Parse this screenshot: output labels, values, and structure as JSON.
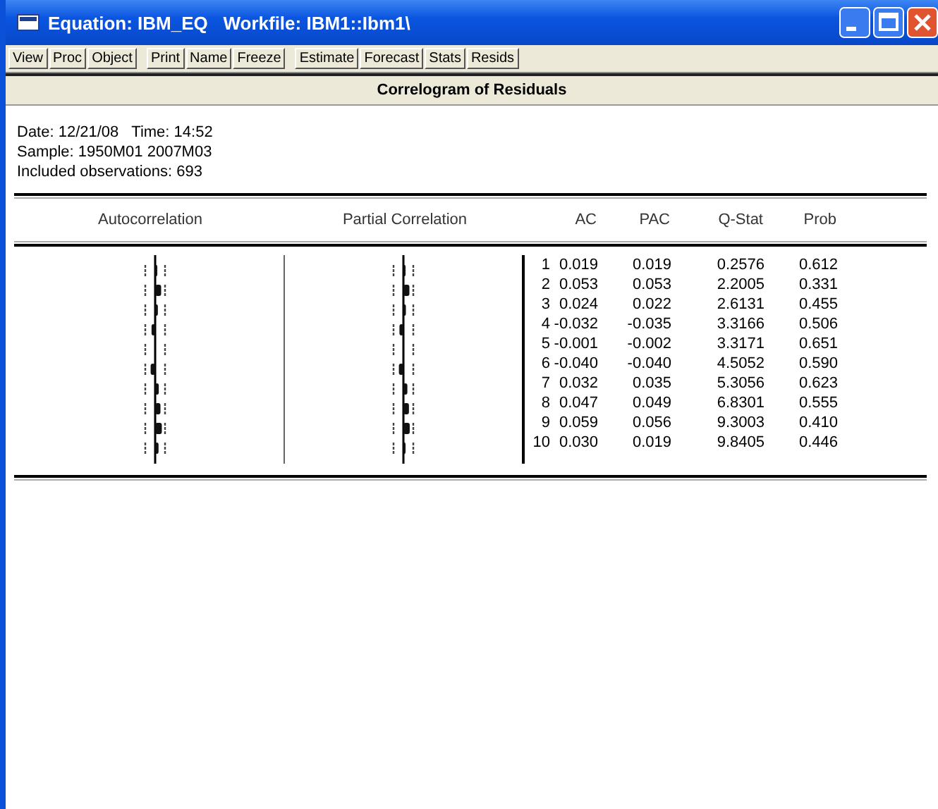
{
  "window": {
    "title": "Equation: IBM_EQ   Workfile: IBM1::Ibm1\\"
  },
  "toolbar": [
    "View",
    "Proc",
    "Object",
    "Print",
    "Name",
    "Freeze",
    "Estimate",
    "Forecast",
    "Stats",
    "Resids"
  ],
  "heading": "Correlogram of Residuals",
  "info": [
    "Date: 12/21/08   Time: 14:52",
    "Sample: 1950M01 2007M03",
    "Included observations: 693"
  ],
  "columns": [
    "Autocorrelation",
    "Partial Correlation",
    "AC",
    "PAC",
    "Q-Stat",
    "Prob"
  ],
  "rows": [
    {
      "lag": "1",
      "ac": "0.019",
      "pac": "0.019",
      "q": "0.2576",
      "prob": "0.612"
    },
    {
      "lag": "2",
      "ac": "0.053",
      "pac": "0.053",
      "q": "2.2005",
      "prob": "0.331"
    },
    {
      "lag": "3",
      "ac": "0.024",
      "pac": "0.022",
      "q": "2.6131",
      "prob": "0.455"
    },
    {
      "lag": "4",
      "ac": "-0.032",
      "pac": "-0.035",
      "q": "3.3166",
      "prob": "0.506"
    },
    {
      "lag": "5",
      "ac": "-0.001",
      "pac": "-0.002",
      "q": "3.3171",
      "prob": "0.651"
    },
    {
      "lag": "6",
      "ac": "-0.040",
      "pac": "-0.040",
      "q": "4.5052",
      "prob": "0.590"
    },
    {
      "lag": "7",
      "ac": "0.032",
      "pac": "0.035",
      "q": "5.3056",
      "prob": "0.623"
    },
    {
      "lag": "8",
      "ac": "0.047",
      "pac": "0.049",
      "q": "6.8301",
      "prob": "0.555"
    },
    {
      "lag": "9",
      "ac": "0.059",
      "pac": "0.056",
      "q": "9.3003",
      "prob": "0.410"
    },
    {
      "lag": "10",
      "ac": "0.030",
      "pac": "0.019",
      "q": "9.8405",
      "prob": "0.446"
    }
  ]
}
